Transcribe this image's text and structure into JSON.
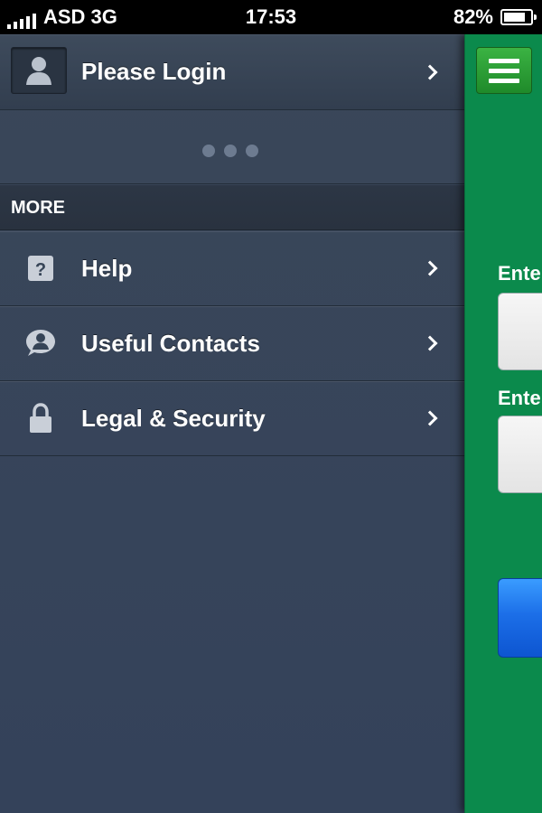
{
  "status_bar": {
    "carrier": "ASD 3G",
    "time": "17:53",
    "battery": "82%",
    "battery_level": 0.82
  },
  "menu": {
    "login": {
      "label": "Please Login",
      "icon": "user-icon"
    },
    "section_header": "MORE",
    "items": [
      {
        "label": "Help",
        "icon": "help-icon"
      },
      {
        "label": "Useful Contacts",
        "icon": "contacts-icon"
      },
      {
        "label": "Legal & Security",
        "icon": "lock-icon"
      }
    ]
  },
  "main_panel": {
    "field1_label": "Ente",
    "field2_label": "Ente",
    "accent_color": "#0b8a4c",
    "button_color": "#1c6fe8"
  }
}
